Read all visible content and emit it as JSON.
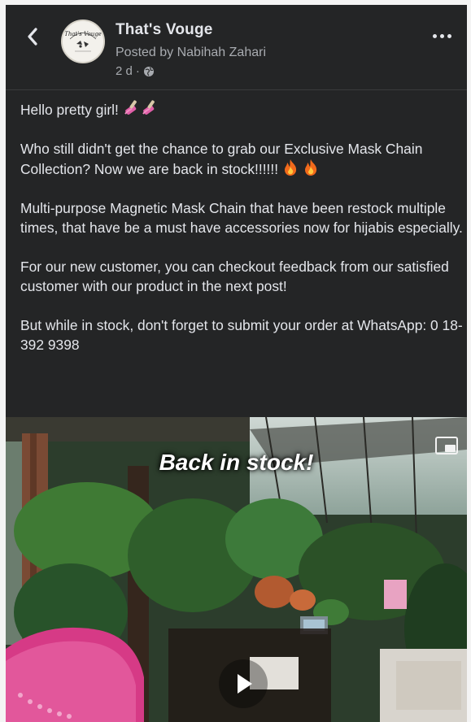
{
  "header": {
    "page_name": "That's Vouge",
    "posted_by": "Posted by Nabihah Zahari",
    "time": "2 d",
    "separator": "·",
    "avatar_text": "That's Vouge",
    "back_icon": "chevron-left-icon",
    "more_icon": "more-horizontal-icon",
    "audience_icon": "globe-icon"
  },
  "post": {
    "p1": "Hello pretty girl! ",
    "p2": "Who still didn't get the chance to grab our Exclusive Mask Chain Collection? Now we are back in stock!!!!!! ",
    "p3": "Multi-purpose Magnetic Mask Chain that have been restock multiple times, that have be a must have accessories now for hijabis especially.",
    "p4": "For our new customer, you can checkout feedback from our satisfied customer with our product in the next post!",
    "p5": "But while in stock, don't forget to submit your order at WhatsApp: 0 18-392 9398"
  },
  "video": {
    "overlay_text": "Back in stock!",
    "play_icon": "play-icon",
    "pip_icon": "picture-in-picture-icon"
  },
  "colors": {
    "background": "#242526",
    "text_primary": "#e4e6eb",
    "text_secondary": "#a8abb0"
  }
}
